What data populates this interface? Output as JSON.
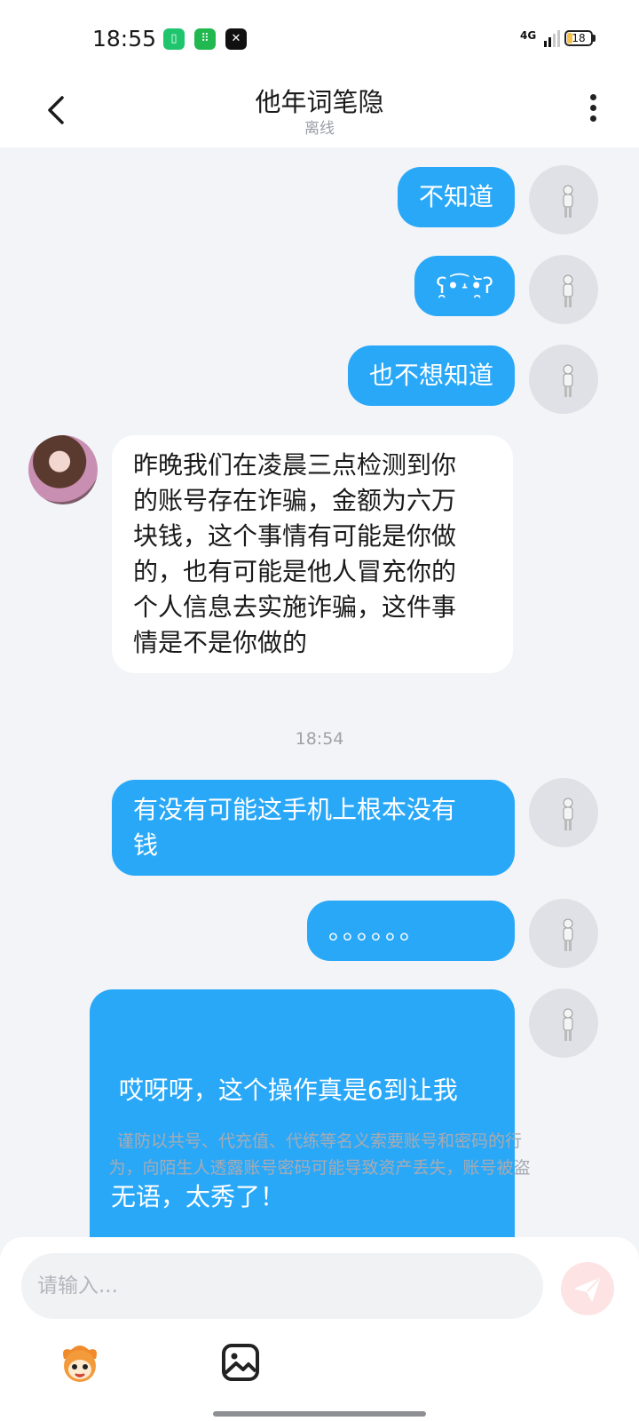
{
  "status_bar": {
    "time": "18:55",
    "network": "4G",
    "battery": "18",
    "app_icons": [
      "battery-saver-icon",
      "shop-icon",
      "capcut-icon"
    ]
  },
  "header": {
    "title": "他年词笔隐",
    "status": "离线"
  },
  "messages": [
    {
      "side": "out",
      "text": "不知道"
    },
    {
      "side": "out",
      "text": "ʕ̯•͡˔•̯᷅ʔ"
    },
    {
      "side": "out",
      "text": "也不想知道"
    },
    {
      "side": "in",
      "lines": [
        "昨晚我们在凌晨三点检测到你",
        "的账号存在诈骗，金额为六万",
        "块钱，这个事情有可能是你做",
        "的，也有可能是他人冒充你的",
        "个人信息去实施诈骗，这件事",
        "情是不是你做的"
      ]
    },
    {
      "side": "time",
      "text": "18:54"
    },
    {
      "side": "out",
      "lines": [
        "有没有可能这手机上根本没有",
        "钱"
      ]
    },
    {
      "side": "out",
      "text": "。。。。。。"
    },
    {
      "side": "out",
      "lines": [
        " 哎呀呀，这个操作真是6到让我",
        "无语，太秀了！"
      ]
    }
  ],
  "notice": {
    "lines": [
      "谨防以共号、代充值、代练等名义索要账号和密码的行",
      "为，向陌生人透露账号密码可能导致资产丢失，账号被盗"
    ]
  },
  "composer": {
    "placeholder": "请输入...",
    "send_icon": "send-icon",
    "emoji_icon": "emoji-mascot-icon",
    "image_icon": "image-icon"
  },
  "colors": {
    "outgoing_bubble": "#2aa8f8",
    "incoming_bubble": "#ffffff",
    "background": "#f2f4f7"
  }
}
